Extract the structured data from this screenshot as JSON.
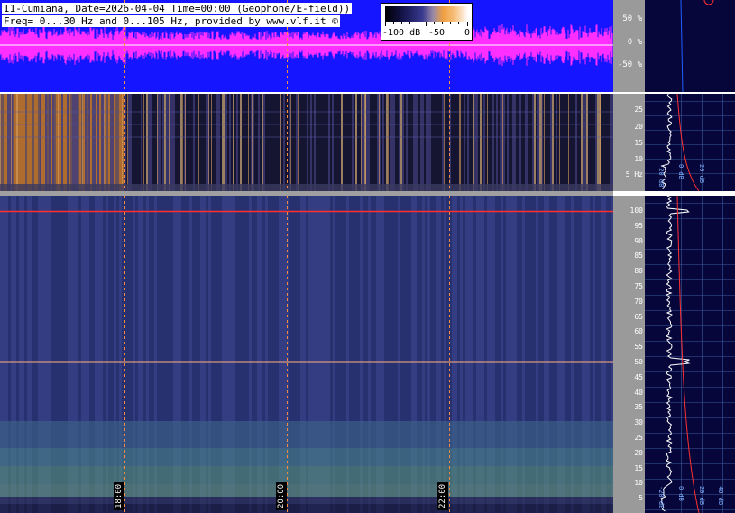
{
  "header": {
    "title_line1": "I1-Cumiana, Date=2026-04-04 Time=00:00 (Geophone/E-field))",
    "title_line2": "Freq= 0...30 Hz and 0...105 Hz, provided by www.vlf.it ©"
  },
  "colorbar": {
    "min_label": "-100 dB",
    "mid_label": "-50",
    "max_label": "0"
  },
  "amplitude_scale": {
    "labels": [
      "50 %",
      "0 %",
      "-50 %"
    ]
  },
  "spectrogram_top": {
    "axis_labels": [
      "25",
      "20",
      "15",
      "10",
      "5 Hz"
    ]
  },
  "spectrogram_bottom": {
    "axis_labels": [
      "100",
      "95",
      "90",
      "85",
      "80",
      "75",
      "70",
      "65",
      "60",
      "55",
      "50",
      "45",
      "40",
      "35",
      "30",
      "25",
      "20",
      "15",
      "10",
      "5"
    ]
  },
  "side_profile": {
    "top_labels": [
      "-20 dB",
      "0 dB",
      "20 dB"
    ],
    "bottom_labels": [
      "-20 dB",
      "0 dB",
      "20 dB",
      "40 dB"
    ]
  },
  "time_marks": [
    "18:00",
    "20:00",
    "22:00"
  ],
  "colors": {
    "header_bg": "#1515ff",
    "waveform": "#ff30ff",
    "marker_line": "#ff8c40",
    "mains_line": "#ff3030"
  }
}
